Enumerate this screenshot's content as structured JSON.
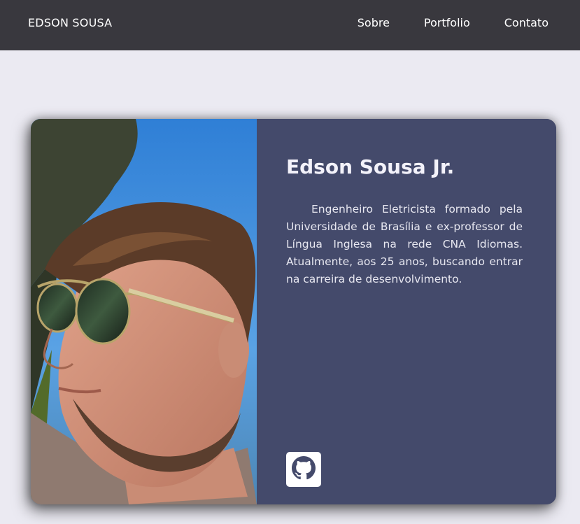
{
  "nav": {
    "brand": "EDSON SOUSA",
    "links": [
      {
        "label": "Sobre"
      },
      {
        "label": "Portfolio"
      },
      {
        "label": "Contato"
      }
    ]
  },
  "profile": {
    "name": "Edson Sousa Jr.",
    "bio": "Engenheiro Eletricista formado pela Universidade de Brasília e ex-professor de Língua Inglesa na rede CNA Idiomas. Atualmente, aos 25 anos, buscando entrar na carreira de desenvolvimento.",
    "social_icon": "github-icon"
  },
  "colors": {
    "navbar": "#39383e",
    "page_background": "#ebeaf2",
    "card_panel": "#444a6b",
    "text": "#ffffff"
  }
}
